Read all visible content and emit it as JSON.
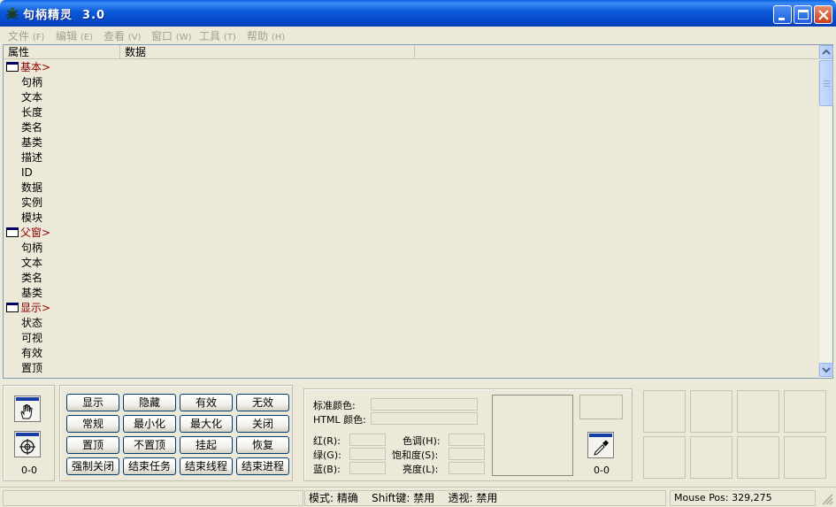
{
  "window": {
    "title": "句柄精灵  3.0"
  },
  "menu": [
    {
      "label": "文件",
      "acc": "(F)"
    },
    {
      "label": "编辑",
      "acc": "(E)"
    },
    {
      "label": "查看",
      "acc": "(V)"
    },
    {
      "label": "窗口",
      "acc": "(W)"
    },
    {
      "label": "工具",
      "acc": "(T)"
    },
    {
      "label": "帮助",
      "acc": "(H)"
    }
  ],
  "grid": {
    "col_property": "属性",
    "col_data": "数据",
    "rows": [
      {
        "type": "group",
        "label": "基本>"
      },
      {
        "type": "child",
        "label": "句柄"
      },
      {
        "type": "child",
        "label": "文本"
      },
      {
        "type": "child",
        "label": "长度"
      },
      {
        "type": "child",
        "label": "类名"
      },
      {
        "type": "child",
        "label": "基类"
      },
      {
        "type": "child",
        "label": "描述"
      },
      {
        "type": "child",
        "label": "ID"
      },
      {
        "type": "child",
        "label": "数据"
      },
      {
        "type": "child",
        "label": "实例"
      },
      {
        "type": "child",
        "label": "模块"
      },
      {
        "type": "group",
        "label": "父窗>"
      },
      {
        "type": "child",
        "label": "句柄"
      },
      {
        "type": "child",
        "label": "文本"
      },
      {
        "type": "child",
        "label": "类名"
      },
      {
        "type": "child",
        "label": "基类"
      },
      {
        "type": "group",
        "label": "显示>"
      },
      {
        "type": "child",
        "label": "状态"
      },
      {
        "type": "child",
        "label": "可视"
      },
      {
        "type": "child",
        "label": "有效"
      },
      {
        "type": "child",
        "label": "置顶"
      }
    ]
  },
  "finder": {
    "hand_icon": "hand-finder-icon",
    "target_icon": "crosshair-finder-icon",
    "coords": "0-0"
  },
  "actions": [
    [
      "显示",
      "隐藏",
      "有效",
      "无效"
    ],
    [
      "常规",
      "最小化",
      "最大化",
      "关闭"
    ],
    [
      "置顶",
      "不置顶",
      "挂起",
      "恢复"
    ],
    [
      "强制关闭",
      "结束任务",
      "结束线程",
      "结束进程"
    ]
  ],
  "color": {
    "std_color_label": "标准颜色:",
    "html_color_label": "HTML 颜色:",
    "red_label": "红(R):",
    "green_label": "绿(G):",
    "blue_label": "蓝(B):",
    "hue_label": "色调(H):",
    "sat_label": "饱和度(S):",
    "lum_label": "亮度(L):",
    "picker_icon": "eyedropper-icon",
    "coords": "0-0"
  },
  "status": {
    "mode": "模式: 精确",
    "shift": "Shift键: 禁用",
    "transparent": "透视: 禁用",
    "mouse_pos": "Mouse Pos: 329,275"
  }
}
